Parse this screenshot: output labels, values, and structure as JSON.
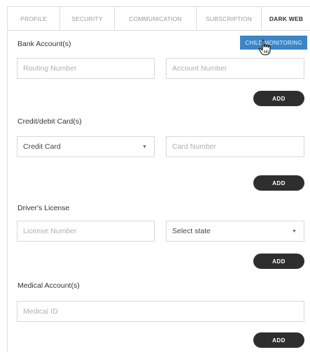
{
  "tabs": [
    {
      "label": "PROFILE"
    },
    {
      "label": "SECURITY"
    },
    {
      "label": "COMMUNICATION"
    },
    {
      "label": "SUBSCRIPTION"
    },
    {
      "label": "DARK WEB"
    }
  ],
  "child_monitoring_label": "CHILD MONITORING",
  "bank": {
    "label": "Bank Account(s)",
    "routing_placeholder": "Routing Number",
    "account_placeholder": "Account Number",
    "add_label": "ADD"
  },
  "cards": {
    "label": "Credit/debit Card(s)",
    "type_value": "Credit Card",
    "number_placeholder": "Card Number",
    "add_label": "ADD"
  },
  "license": {
    "label": "Driver's License",
    "number_placeholder": "License Number",
    "state_value": "Select state",
    "add_label": "ADD"
  },
  "medical": {
    "label": "Medical Account(s)",
    "id_placeholder": "Medical ID",
    "add_label": "ADD"
  },
  "icons": {
    "cursor": "hand-pointer-icon",
    "dropdown": "caret-down-icon"
  }
}
